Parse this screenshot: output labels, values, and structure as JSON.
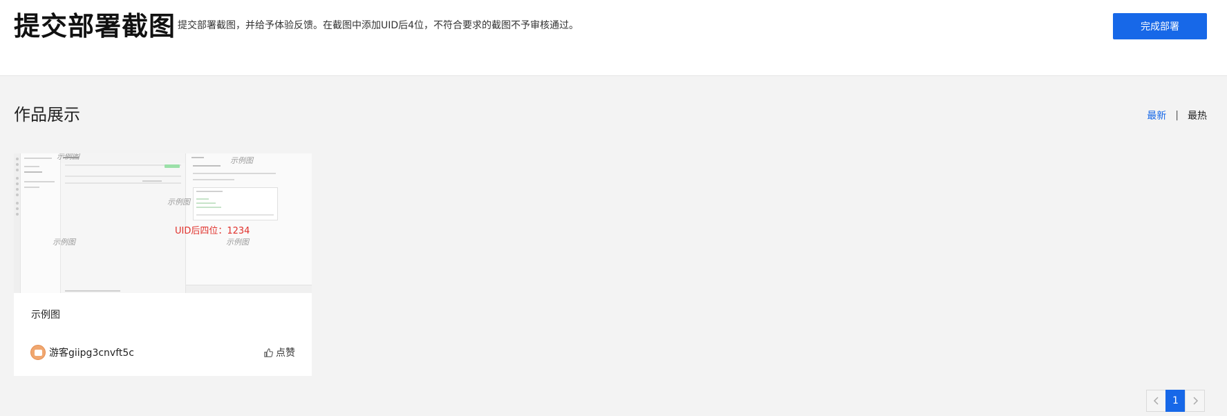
{
  "header": {
    "title": "提交部署截图",
    "description": "提交部署截图，并给予体验反馈。在截图中添加UID后4位，不符合要求的截图不予审核通过。",
    "finish_button": "完成部署"
  },
  "gallery": {
    "section_title": "作品展示",
    "sort_tabs": [
      {
        "label": "最新",
        "active": true
      },
      {
        "label": "最热",
        "active": false
      }
    ],
    "separator": "|",
    "cards": [
      {
        "caption": "示例图",
        "watermark": "示例图",
        "uid_label": "UID后四位：1234",
        "author": "游客giipg3cnvft5c",
        "like_label": "点赞"
      }
    ]
  },
  "pagination": {
    "prev_icon": "chevron-left-icon",
    "current_page": "1",
    "next_icon": "chevron-right-icon"
  },
  "colors": {
    "accent": "#1768e8",
    "uid_red": "#e0302b"
  }
}
